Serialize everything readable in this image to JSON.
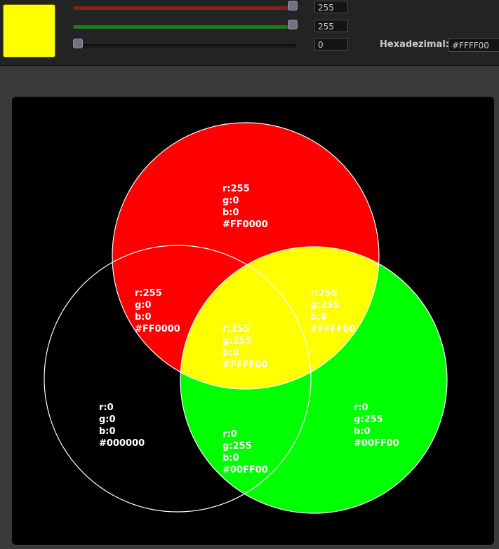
{
  "colors": {
    "preview": "#FFFF00",
    "red_slider": "#8b1f1f",
    "green_slider": "#1f7a1f",
    "stage_bg": "#000000",
    "circle_outline": "#ffffff"
  },
  "controls": {
    "red": {
      "value": "255",
      "level_percent": 100
    },
    "green": {
      "value": "255",
      "level_percent": 100
    },
    "blue": {
      "value": "0",
      "level_percent": 0
    },
    "hex_label": "Hexadezimal:",
    "hex_value": "#FFFF00"
  },
  "venn": {
    "regions": [
      {
        "id": "red-only",
        "fill": "#FF0000",
        "r": "r:255",
        "g": "g:0",
        "b": "b:0",
        "hex": "#FF0000"
      },
      {
        "id": "red-black",
        "fill": "#FF0000",
        "r": "r:255",
        "g": "g:0",
        "b": "b:0",
        "hex": "#FF0000"
      },
      {
        "id": "red-green",
        "fill": "#FFFF00",
        "r": "r:255",
        "g": "g:255",
        "b": "b:0",
        "hex": "#FFFF00"
      },
      {
        "id": "center",
        "fill": "#FFFF00",
        "r": "r:255",
        "g": "g:255",
        "b": "b:0",
        "hex": "#FFFF00"
      },
      {
        "id": "black-only",
        "fill": "#000000",
        "r": "r:0",
        "g": "g:0",
        "b": "b:0",
        "hex": "#000000"
      },
      {
        "id": "green-black",
        "fill": "#00FF00",
        "r": "r:0",
        "g": "g:255",
        "b": "b:0",
        "hex": "#00FF00"
      },
      {
        "id": "green-only",
        "fill": "#00FF00",
        "r": "r:0",
        "g": "g:255",
        "b": "b:0",
        "hex": "#00FF00"
      }
    ]
  }
}
